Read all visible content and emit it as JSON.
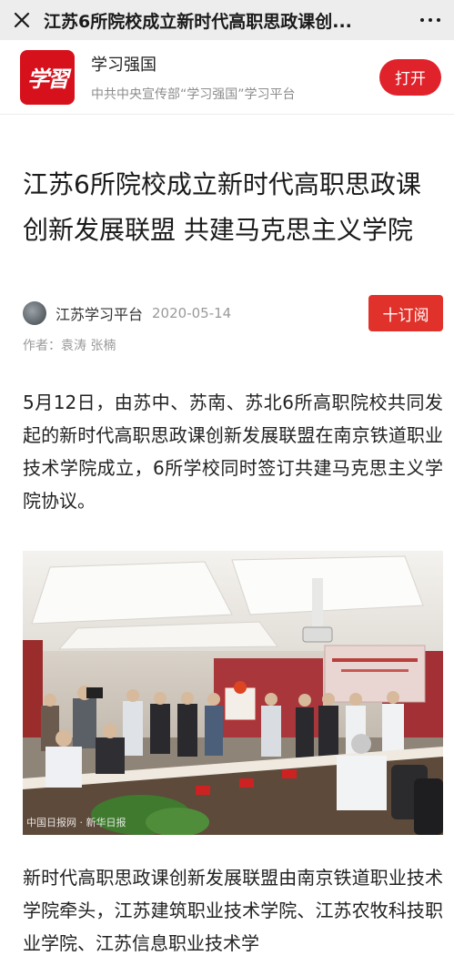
{
  "nav": {
    "title": "江苏6所院校成立新时代高职思政课创..."
  },
  "banner": {
    "logo_text": "学習",
    "app_name": "学习强国",
    "app_sub": "中共中央宣传部“学习强国”学习平台",
    "open_label": "打开"
  },
  "article": {
    "title": "江苏6所院校成立新时代高职思政课创新发展联盟 共建马克思主义学院",
    "source_name": "江苏学习平台",
    "date": "2020-05-14",
    "subscribe_label": "十订阅",
    "authors": "作者：袁涛 张楠",
    "paragraph1": "5月12日，由苏中、苏南、苏北6所高职院校共同发起的新时代高职思政课创新发展联盟在南京铁道职业技术学院成立，6所学校同时签订共建马克思主义学院协议。",
    "paragraph2": "新时代高职思政课创新发展联盟由南京铁道职业技术学院牵头，江苏建筑职业技术学院、江苏农牧科技职业学院、江苏信息职业技术学"
  },
  "photo": {
    "screen_text": "新时代高职思政课创新发展联盟成立暨共建马院签约仪式",
    "plaque_text": "新时代高职思政课创新发展联盟",
    "watermark": "中国日报网 · 新华日报"
  },
  "colors": {
    "brand_red": "#e0222b",
    "nav_bg": "#ededed"
  }
}
